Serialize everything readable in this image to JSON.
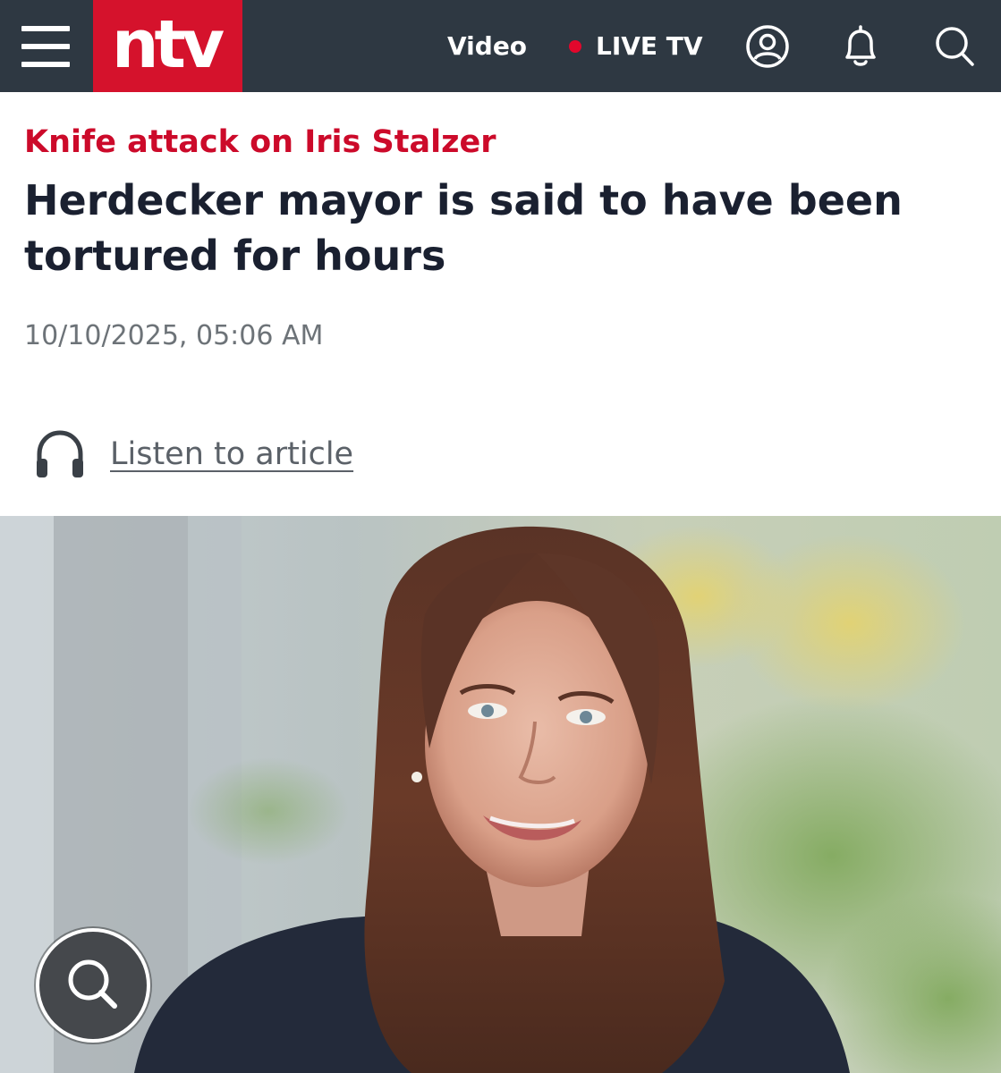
{
  "nav": {
    "logo": "ntv",
    "video_label": "Video",
    "live_label": "LIVE TV",
    "icons": [
      "menu-icon",
      "user-icon",
      "bell-icon",
      "search-icon"
    ],
    "live_dot_color": "#e3072c",
    "bar_color": "#2e3842",
    "logo_color": "#d5122c"
  },
  "article": {
    "kicker": "Knife attack on Iris Stalzer",
    "headline": "Herdecker mayor is said to have been tortured for hours",
    "date": "10/10/2025, 05:06 AM",
    "listen_label": "Listen to article",
    "listen_icon": "headphones-icon",
    "kicker_color": "#cc0a2a"
  },
  "hero": {
    "zoom_icon": "magnifier-icon"
  }
}
